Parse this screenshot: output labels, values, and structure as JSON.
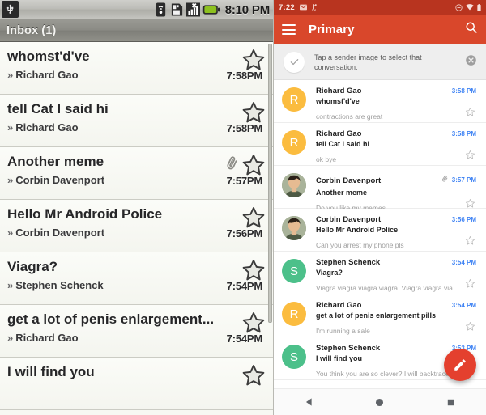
{
  "left": {
    "status_bar": {
      "clock": "8:10 PM",
      "icons": [
        "usb-icon",
        "wifi-icon",
        "sdcard-icon",
        "signal-no-service-icon",
        "battery-icon"
      ]
    },
    "title_bar": {
      "title": "Inbox (1)"
    },
    "rows": [
      {
        "subject": "whomst'd've",
        "chevron": "»",
        "sender": "Richard Gao",
        "time": "7:58PM",
        "starred": false,
        "attachment": false
      },
      {
        "subject": "tell Cat I said hi",
        "chevron": "»",
        "sender": "Richard Gao",
        "time": "7:58PM",
        "starred": false,
        "attachment": false
      },
      {
        "subject": "Another meme",
        "chevron": "»",
        "sender": "Corbin Davenport",
        "time": "7:57PM",
        "starred": false,
        "attachment": true
      },
      {
        "subject": "Hello Mr Android Police",
        "chevron": "»",
        "sender": "Corbin Davenport",
        "time": "7:56PM",
        "starred": false,
        "attachment": false
      },
      {
        "subject": "Viagra?",
        "chevron": "»",
        "sender": "Stephen Schenck",
        "time": "7:54PM",
        "starred": false,
        "attachment": false
      },
      {
        "subject": "get a lot of penis enlargement...",
        "chevron": "»",
        "sender": "Richard Gao",
        "time": "7:54PM",
        "starred": false,
        "attachment": false
      },
      {
        "subject": "I will find you",
        "chevron": "",
        "sender": "",
        "time": "",
        "starred": false,
        "attachment": false
      }
    ]
  },
  "right": {
    "status_bar": {
      "time": "7:22",
      "icons": [
        "mail-icon",
        "usb-debug-icon",
        "dnd-icon",
        "wifi-icon",
        "battery-icon"
      ]
    },
    "app_bar": {
      "menu_icon": "hamburger-icon",
      "title": "Primary",
      "search_icon": "search-icon"
    },
    "tip": {
      "check_icon": "check-icon",
      "text": "Tap a sender image to select that conversation.",
      "close_icon": "close-icon"
    },
    "rows": [
      {
        "avatar_letter": "R",
        "avatar_color": "#fbbc3f",
        "avatar_type": "letter",
        "sender": "Richard Gao",
        "subject": "whomst'd've",
        "snippet": "contractions are great",
        "time": "3:58 PM",
        "attachment": false,
        "starred": false
      },
      {
        "avatar_letter": "R",
        "avatar_color": "#fbbc3f",
        "avatar_type": "letter",
        "sender": "Richard Gao",
        "subject": "tell Cat I said hi",
        "snippet": "ok bye",
        "time": "3:58 PM",
        "attachment": false,
        "starred": false
      },
      {
        "avatar_letter": "",
        "avatar_color": "#8a9a7c",
        "avatar_type": "photo",
        "sender": "Corbin Davenport",
        "subject": "Another meme",
        "snippet": "Do you like my memes",
        "time": "3:57 PM",
        "attachment": true,
        "starred": false
      },
      {
        "avatar_letter": "",
        "avatar_color": "#8a9a7c",
        "avatar_type": "photo",
        "sender": "Corbin Davenport",
        "subject": "Hello Mr Android Police",
        "snippet": "Can you arrest my phone pls",
        "time": "3:56 PM",
        "attachment": false,
        "starred": false
      },
      {
        "avatar_letter": "S",
        "avatar_color": "#4cc08a",
        "avatar_type": "letter",
        "sender": "Stephen Schenck",
        "subject": "Viagra?",
        "snippet": "Viagra viagra viagra viagra. Viagra viagra viagra ...",
        "time": "3:54 PM",
        "attachment": false,
        "starred": false
      },
      {
        "avatar_letter": "R",
        "avatar_color": "#fbbc3f",
        "avatar_type": "letter",
        "sender": "Richard Gao",
        "subject": "get a lot of penis enlargement pills",
        "snippet": "I'm running a sale",
        "time": "3:54 PM",
        "attachment": false,
        "starred": false
      },
      {
        "avatar_letter": "S",
        "avatar_color": "#4cc08a",
        "avatar_type": "letter",
        "sender": "Stephen Schenck",
        "subject": "I will find you",
        "snippet": "You think you are so clever? I will backtrace your ...",
        "time": "3:53 PM",
        "attachment": false,
        "starred": false
      }
    ],
    "fab": {
      "icon": "compose-pencil-icon",
      "color": "#e4402e"
    },
    "nav_bar": {
      "back": "back-icon",
      "home": "home-icon",
      "recents": "recents-icon"
    }
  },
  "colors": {
    "material_red": "#d9472b",
    "status_red": "#b8341f",
    "accent_blue": "#4285f4",
    "avatar_orange": "#fbbc3f",
    "avatar_green": "#4cc08a"
  }
}
